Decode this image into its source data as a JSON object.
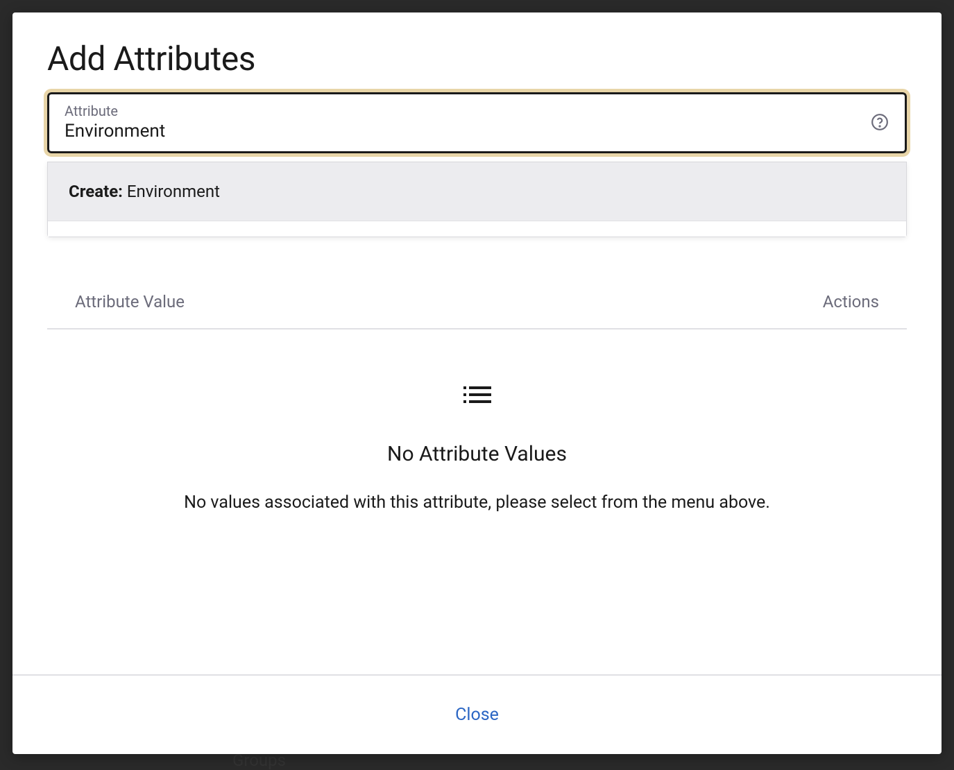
{
  "modal": {
    "title": "Add Attributes",
    "input": {
      "label": "Attribute",
      "value": "Environment"
    },
    "dropdown": {
      "create_prefix": "Create:",
      "create_value": "Environment"
    },
    "table": {
      "col_value": "Attribute Value",
      "col_actions": "Actions"
    },
    "empty": {
      "title": "No Attribute Values",
      "text": "No values associated with this attribute, please select from the menu above."
    },
    "close_label": "Close"
  }
}
